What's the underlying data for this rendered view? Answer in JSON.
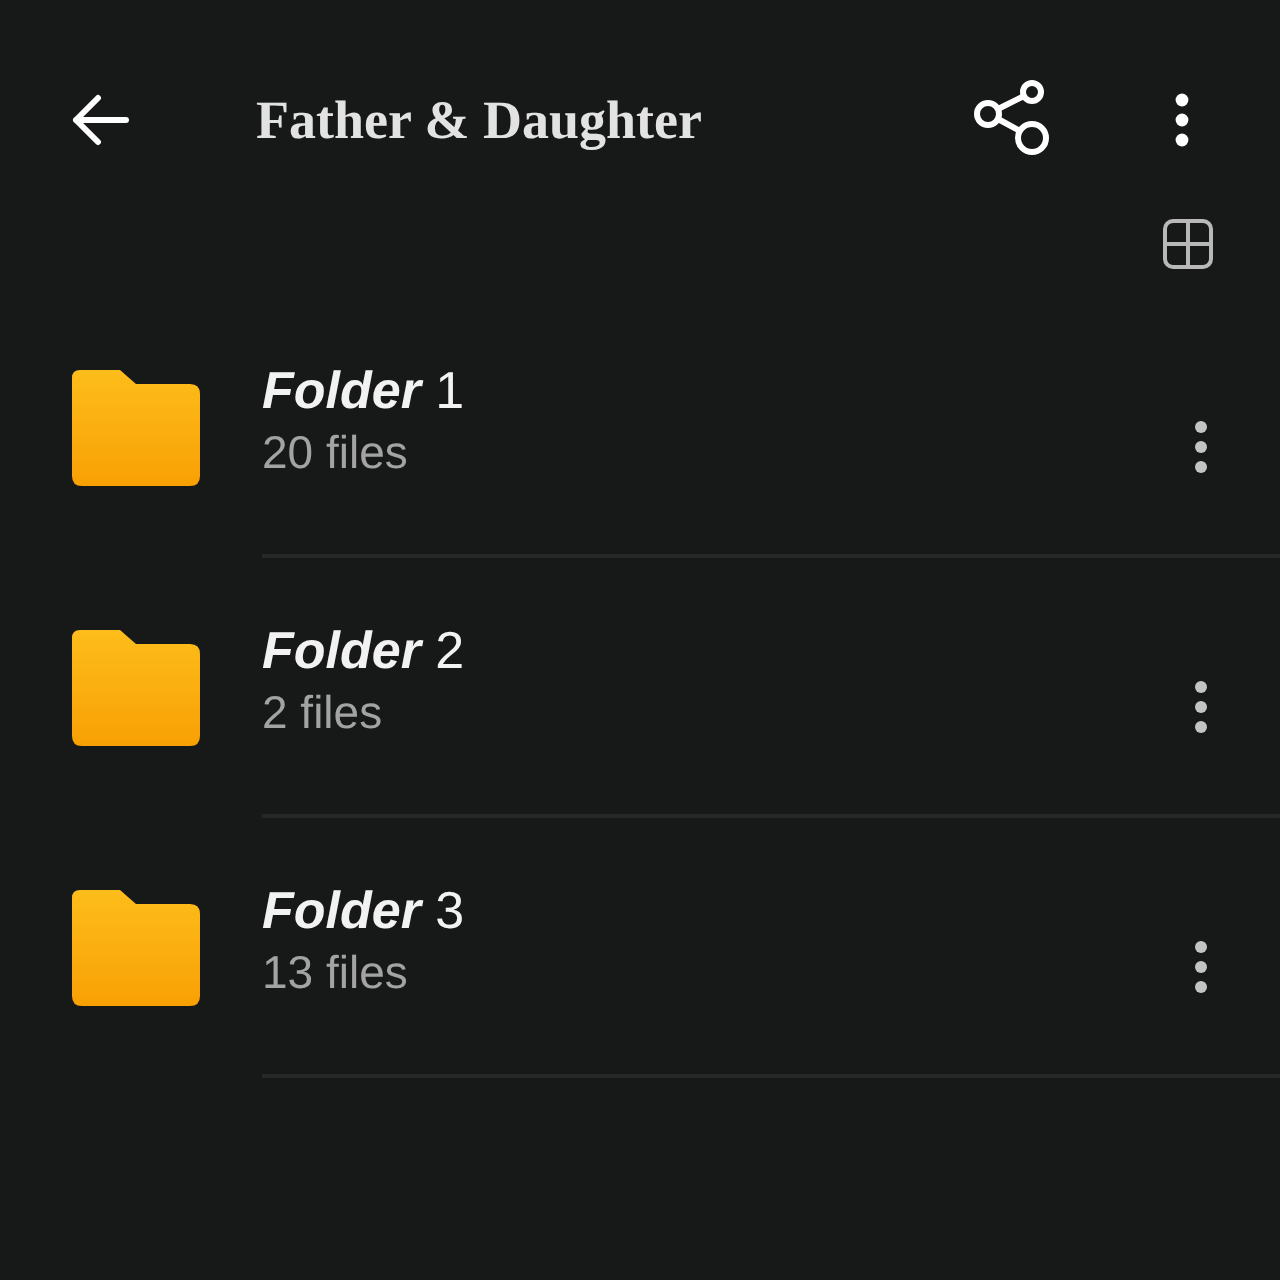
{
  "top_bar": {
    "title": "Father & Daughter"
  },
  "folders": [
    {
      "name": "**Folder** 1",
      "count": "20 files"
    },
    {
      "name": "**Folder** 2",
      "count": "2 files"
    },
    {
      "name": "**Folder** 3",
      "count": "13 files"
    }
  ]
}
